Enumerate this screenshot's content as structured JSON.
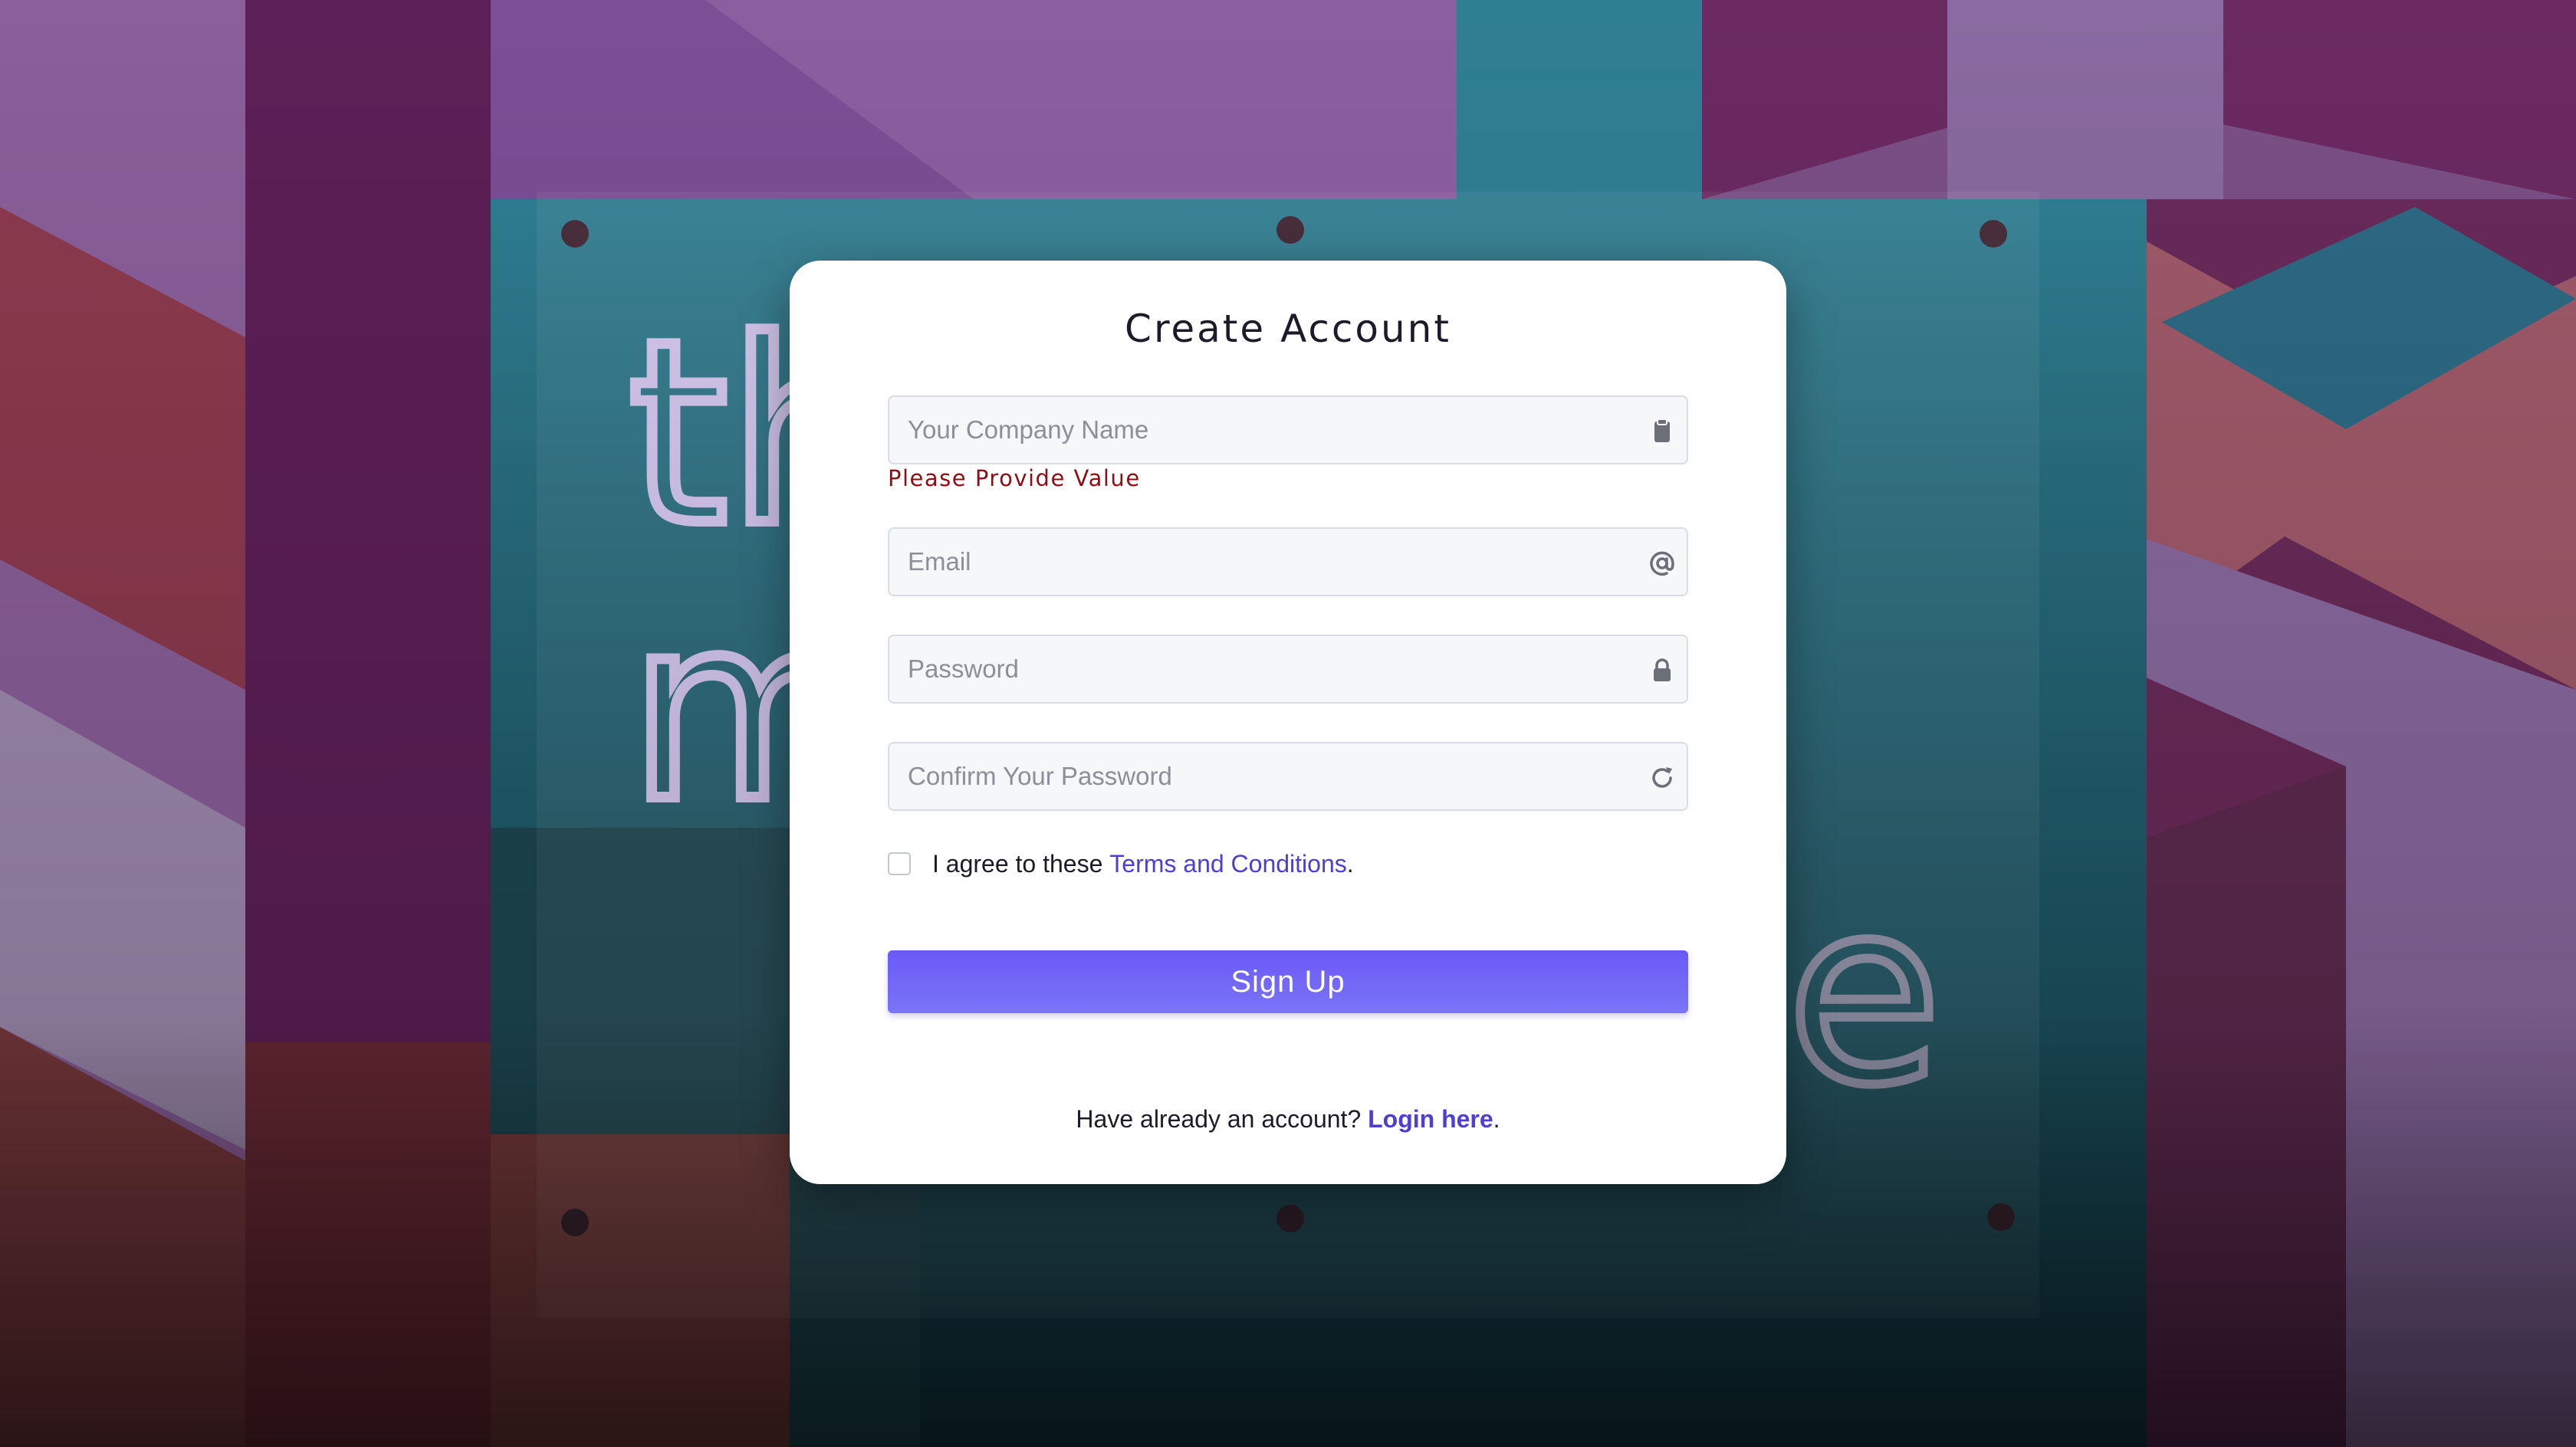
{
  "form": {
    "title": "Create Account",
    "company": {
      "placeholder": "Your Company Name",
      "value": "",
      "icon": "clipboard-icon"
    },
    "company_error": "Please Provide Value",
    "email": {
      "placeholder": "Email",
      "value": "",
      "icon": "at-sign-icon"
    },
    "password": {
      "placeholder": "Password",
      "value": "",
      "icon": "lock-icon"
    },
    "confirm_password": {
      "placeholder": "Confirm Your Password",
      "value": "",
      "icon": "refresh-icon"
    },
    "terms": {
      "checked": false,
      "text_before": "I agree to these",
      "link_label": "Terms and Conditions",
      "text_after": "."
    },
    "submit_label": "Sign Up",
    "footer": {
      "text_before": "Have already an account?",
      "link_label": "Login here",
      "text_after": "."
    }
  },
  "background": {
    "neon_letters": [
      "th",
      "m",
      "e"
    ]
  },
  "colors": {
    "accent": "#6a5af6",
    "link": "#4c3fd1",
    "error": "#8b0f15",
    "card": "#ffffff",
    "field_bg": "#f6f7f9"
  }
}
